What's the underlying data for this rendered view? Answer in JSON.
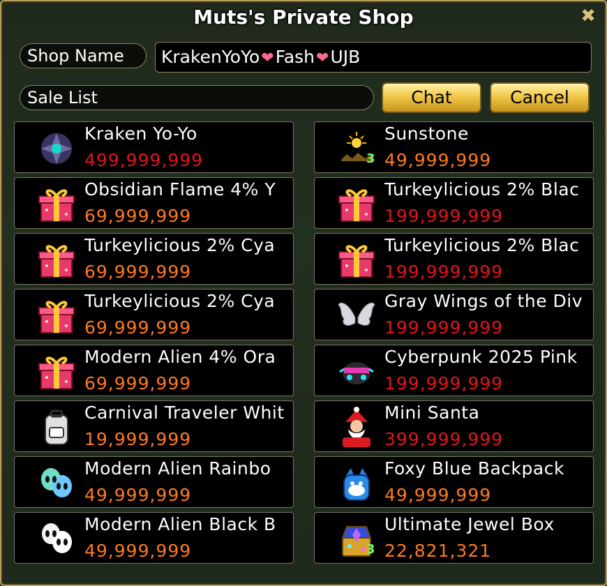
{
  "window": {
    "title": "Muts's Private Shop",
    "close_symbol": "✖"
  },
  "shop": {
    "name_label": "Shop Name",
    "name_parts": [
      "KrakenYoYo",
      "Fash",
      "UJB"
    ],
    "sale_list_label": "Sale List",
    "chat_label": "Chat",
    "cancel_label": "Cancel"
  },
  "colors": {
    "price_orange": "#ff7a1e",
    "price_red": "#e0141c",
    "quantity": "#6dff6d"
  },
  "items": [
    {
      "name": "Kraken Yo-Yo",
      "price": "499,999,999",
      "price_color": "red",
      "icon": "yoyo-icon",
      "qty": ""
    },
    {
      "name": "Sunstone",
      "price": "49,999,999",
      "price_color": "orange",
      "icon": "sunstone-icon",
      "qty": "3"
    },
    {
      "name": "Obsidian Flame 4% Y",
      "price": "69,999,999",
      "price_color": "orange",
      "icon": "gift-box-icon",
      "qty": ""
    },
    {
      "name": "Turkeylicious 2% Blac",
      "price": "199,999,999",
      "price_color": "red",
      "icon": "gift-box-icon",
      "qty": ""
    },
    {
      "name": "Turkeylicious 2% Cya",
      "price": "69,999,999",
      "price_color": "orange",
      "icon": "gift-box-icon",
      "qty": ""
    },
    {
      "name": "Turkeylicious 2% Blac",
      "price": "199,999,999",
      "price_color": "red",
      "icon": "gift-box-icon",
      "qty": ""
    },
    {
      "name": "Turkeylicious 2% Cya",
      "price": "69,999,999",
      "price_color": "orange",
      "icon": "gift-box-icon",
      "qty": ""
    },
    {
      "name": "Gray Wings of the Div",
      "price": "199,999,999",
      "price_color": "red",
      "icon": "wings-icon",
      "qty": ""
    },
    {
      "name": "Modern Alien 4% Ora",
      "price": "69,999,999",
      "price_color": "orange",
      "icon": "gift-box-icon",
      "qty": ""
    },
    {
      "name": "Cyberpunk 2025 Pink",
      "price": "199,999,999",
      "price_color": "red",
      "icon": "cyberpunk-mask-icon",
      "qty": ""
    },
    {
      "name": "Carnival Traveler Whit",
      "price": "19,999,999",
      "price_color": "orange",
      "icon": "backpack-icon",
      "qty": ""
    },
    {
      "name": "Mini Santa",
      "price": "399,999,999",
      "price_color": "red",
      "icon": "santa-icon",
      "qty": ""
    },
    {
      "name": "Modern Alien Rainbo",
      "price": "49,999,999",
      "price_color": "orange",
      "icon": "alien-balloons-icon",
      "qty": ""
    },
    {
      "name": "Foxy Blue Backpack",
      "price": "49,999,999",
      "price_color": "orange",
      "icon": "blue-backpack-icon",
      "qty": ""
    },
    {
      "name": "Modern Alien Black B",
      "price": "49,999,999",
      "price_color": "orange",
      "icon": "alien-balloons-white-icon",
      "qty": ""
    },
    {
      "name": "Ultimate Jewel Box",
      "price": "22,821,321",
      "price_color": "orange",
      "icon": "jewel-box-icon",
      "qty": "3"
    }
  ]
}
